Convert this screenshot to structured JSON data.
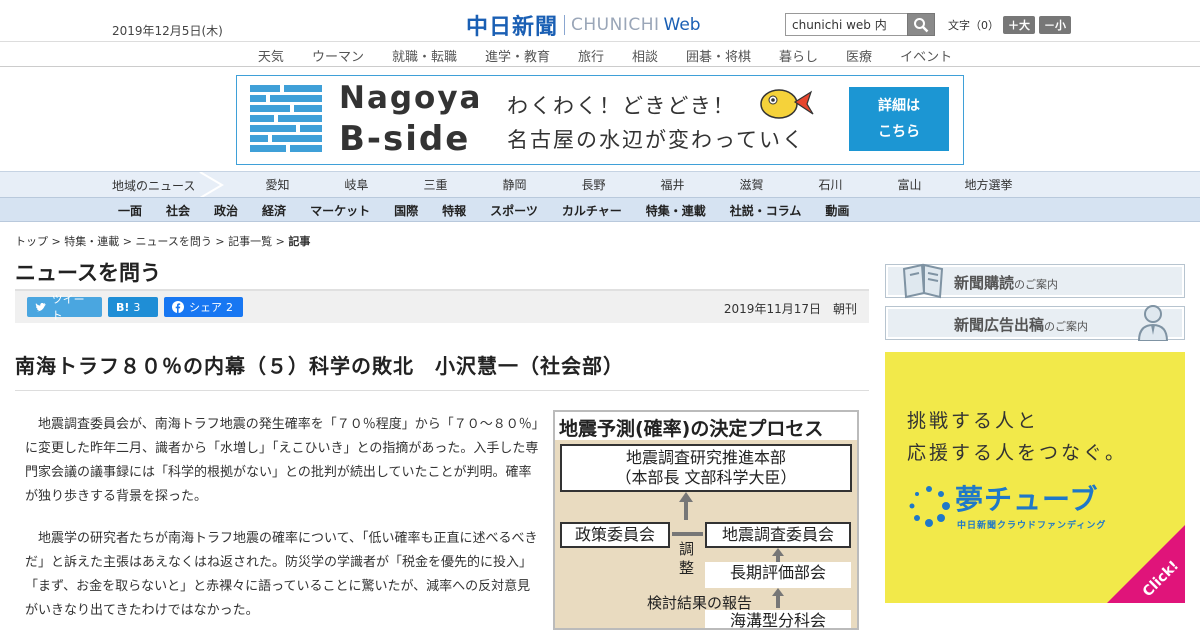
{
  "header": {
    "date": "2019年12月5日(木)",
    "logo_jp": "中日新聞",
    "logo_en": "CHUNICHI",
    "logo_web": "Web",
    "search_value": "chunichi web 内",
    "font_label": "文字（0）",
    "font_larger": "＋大",
    "font_smaller": "－小"
  },
  "topnav": [
    "天気",
    "ウーマン",
    "就職・転職",
    "進学・教育",
    "旅行",
    "相談",
    "囲碁・将棋",
    "暮らし",
    "医療",
    "イベント"
  ],
  "banner": {
    "title1": "Nagoya",
    "title2": "B-side",
    "line1": "わくわく！どきどき！",
    "line2": "名古屋の水辺が変わっていく",
    "cta_line1": "詳細は",
    "cta_line2": "こちら"
  },
  "regionbar": {
    "label": "地域のニュース",
    "items": [
      "愛知",
      "岐阜",
      "三重",
      "静岡",
      "長野",
      "福井",
      "滋賀",
      "石川",
      "富山",
      "地方選挙"
    ]
  },
  "sections": [
    "一面",
    "社会",
    "政治",
    "経済",
    "マーケット",
    "国際",
    "特報",
    "スポーツ",
    "カルチャー",
    "特集・連載",
    "社説・コラム",
    "動画"
  ],
  "breadcrumb": {
    "items": [
      "トップ",
      "特集・連載",
      "ニュースを問う",
      "記事一覧"
    ],
    "separator": ">",
    "current": "記事"
  },
  "article": {
    "section_title": "ニュースを問う",
    "share": {
      "tweet": "ツイート",
      "hatena_icon": "B!",
      "hatena_count": "3",
      "facebook": "シェア",
      "facebook_count": "2"
    },
    "pubdate": "2019年11月17日　朝刊",
    "headline": "南海トラフ８０％の内幕（５）科学の敗北　小沢慧一（社会部）",
    "paragraphs": [
      "地震調査委員会が、南海トラフ地震の発生確率を「７０％程度」から「７０～８０％」に変更した昨年二月、識者から「水増し」「えこひいき」との指摘があった。入手した専門家会議の議事録には「科学的根拠がない」との批判が続出していたことが判明。確率が独り歩きする背景を探った。",
      "地震学の研究者たちが南海トラフ地震の確率について、「低い確率も正直に述べるべきだ」と訴えた主張はあえなくはね返された。防災学の学識者が「税金を優先的に投入」「まず、お金を取らないと」と赤裸々に語っていることに驚いたが、減率への反対意見がいきなり出てきたわけではなかった。"
    ]
  },
  "figure": {
    "title": "地震予測(確率)の決定プロセス",
    "hq_line1": "地震調査研究推進本部",
    "hq_line2": "（本部長 文部科学大臣）",
    "policy": "政策委員会",
    "quake": "地震調査委員会",
    "adjust": "調整",
    "long_term": "長期評価部会",
    "report": "検討結果の報告",
    "trough": "海溝型分科会"
  },
  "sidebar": {
    "subscribe_main": "新聞購読",
    "subscribe_sub": "のご案内",
    "ad_main": "新聞広告出稿",
    "ad_sub": "のご案内",
    "promo_line1": "挑戦する人と",
    "promo_line2": "応援する人をつなぐ。",
    "promo_logo": "夢チューブ",
    "promo_sub": "中日新聞クラウドファンディング",
    "promo_click": "Click!"
  },
  "colors": {
    "brand_blue": "#1a5fb4",
    "banner_blue": "#1c96d3",
    "promo_yellow": "#f2e94a",
    "promo_pink": "#e0147a"
  }
}
